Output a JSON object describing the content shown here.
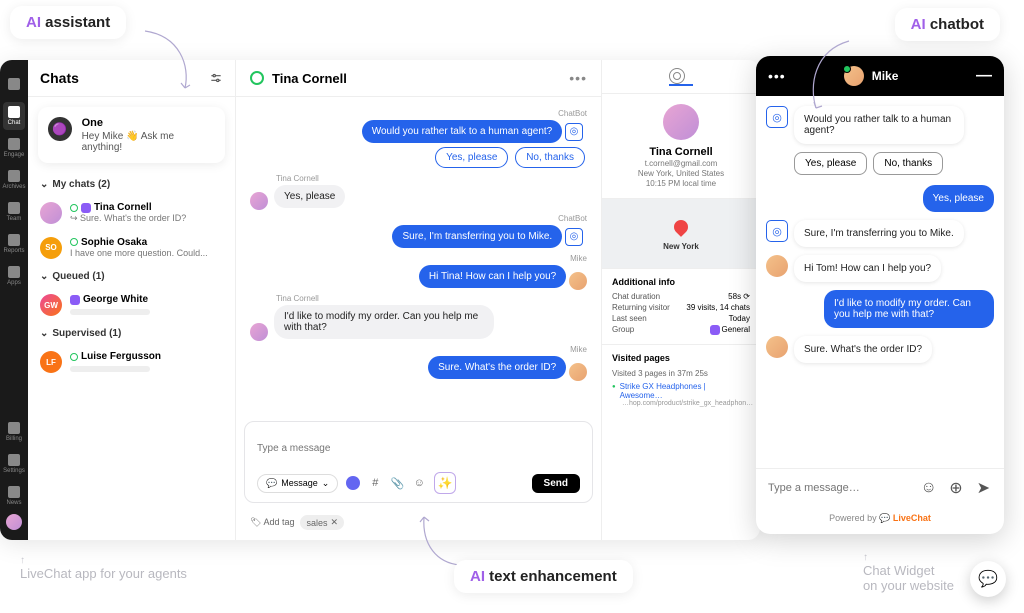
{
  "labels": {
    "ai_assistant_ai": "AI",
    "ai_assistant": "assistant",
    "ai_chatbot_ai": "AI",
    "ai_chatbot": "chatbot",
    "ai_text_ai": "AI",
    "ai_text": "text enhancement"
  },
  "nav": {
    "items": [
      "",
      "Chat",
      "Engage",
      "Archives",
      "Team",
      "Reports",
      "Apps"
    ],
    "bottom": [
      "Billing",
      "Settings",
      "News"
    ]
  },
  "chats": {
    "title": "Chats",
    "one": {
      "name": "One",
      "text": "Hey Mike 👋 Ask me anything!"
    },
    "groups": [
      {
        "label": "My chats (2)",
        "items": [
          {
            "name": "Tina Cornell",
            "preview": "Sure. What's the order ID?",
            "avatar": "tina",
            "reply_icon": true
          },
          {
            "name": "Sophie Osaka",
            "preview": "I have one more question. Could...",
            "avatar": "SO"
          }
        ]
      },
      {
        "label": "Queued (1)",
        "items": [
          {
            "name": "George White",
            "preview": "",
            "avatar": "GW",
            "bar": true
          }
        ]
      },
      {
        "label": "Supervised (1)",
        "items": [
          {
            "name": "Luise Fergusson",
            "preview": "",
            "avatar": "LF",
            "bar": true
          }
        ]
      }
    ]
  },
  "conversation": {
    "title": "Tina Cornell",
    "messages": [
      {
        "who": "ChatBot",
        "side": "right",
        "icon": "bot",
        "bubbles": [
          {
            "style": "blue",
            "text": "Would you rather talk to a human agent?"
          }
        ],
        "options": [
          "Yes, please",
          "No, thanks"
        ]
      },
      {
        "who": "Tina Cornell",
        "side": "left",
        "avatar": "tina",
        "bubbles": [
          {
            "style": "gray",
            "text": "Yes, please"
          }
        ]
      },
      {
        "who": "ChatBot",
        "side": "right",
        "icon": "bot",
        "bubbles": [
          {
            "style": "blue",
            "text": "Sure, I'm transferring you to Mike."
          }
        ]
      },
      {
        "who": "Mike",
        "side": "right",
        "avatar": "mike",
        "bubbles": [
          {
            "style": "blue",
            "text": "Hi Tina! How can I help you?"
          }
        ]
      },
      {
        "who": "Tina Cornell",
        "side": "left",
        "avatar": "tina",
        "bubbles": [
          {
            "style": "gray",
            "text": "I'd like to modify my order. Can you help me with that?"
          }
        ]
      },
      {
        "who": "Mike",
        "side": "right",
        "avatar": "mike",
        "bubbles": [
          {
            "style": "blue",
            "text": "Sure. What's the order ID?"
          }
        ]
      }
    ],
    "composer": {
      "placeholder": "Type a message",
      "message_btn": "Message",
      "send": "Send",
      "add_tag": "Add tag",
      "tag": "sales"
    }
  },
  "details": {
    "name": "Tina Cornell",
    "email": "t.cornell@gmail.com",
    "location": "New York, United States",
    "time": "10:15 PM local time",
    "map_city": "New York",
    "additional_title": "Additional info",
    "rows": [
      {
        "k": "Chat duration",
        "v": "58s ⟳"
      },
      {
        "k": "Returning visitor",
        "v": "39 visits, 14 chats"
      },
      {
        "k": "Last seen",
        "v": "Today"
      },
      {
        "k": "Group",
        "v": "General",
        "badge": true
      }
    ],
    "visited_title": "Visited pages",
    "visited_summary": "Visited 3 pages in 37m 25s",
    "visited_link": "Strike GX Headphones | Awesome…",
    "visited_sub": "…hop.com/product/strike_gx_headphon…"
  },
  "widget": {
    "agent": "Mike",
    "messages": [
      {
        "side": "left",
        "icon": "bot",
        "style": "white",
        "text": "Would you rather talk to a human agent?"
      }
    ],
    "options": [
      "Yes, please",
      "No, thanks"
    ],
    "thread": [
      {
        "side": "right",
        "style": "blue",
        "text": "Yes, please"
      },
      {
        "side": "left",
        "icon": "bot",
        "style": "white",
        "text": "Sure, I'm transferring you to Mike."
      },
      {
        "side": "left",
        "avatar": "mike",
        "style": "white",
        "text": "Hi Tom! How can I help you?"
      },
      {
        "side": "right",
        "style": "blue",
        "text": "I'd like to modify my order. Can you help me with that?"
      },
      {
        "side": "left",
        "avatar": "mike",
        "style": "white",
        "text": "Sure. What's the order ID?"
      }
    ],
    "placeholder": "Type a message…",
    "powered": "Powered by",
    "brand": "LiveChat"
  },
  "captions": {
    "left": "LiveChat app for your agents",
    "right1": "Chat Widget",
    "right2": "on your website"
  }
}
